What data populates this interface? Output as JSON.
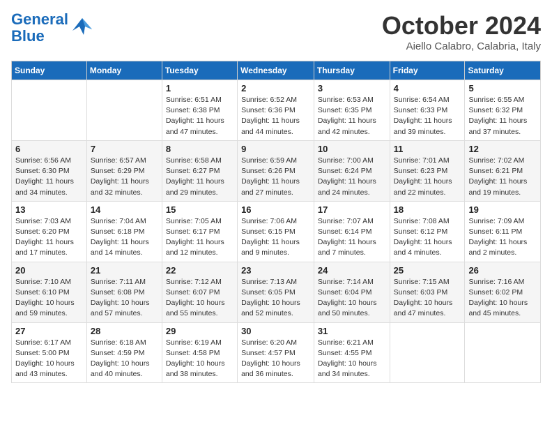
{
  "logo": {
    "line1": "General",
    "line2": "Blue"
  },
  "header": {
    "title": "October 2024",
    "location": "Aiello Calabro, Calabria, Italy"
  },
  "weekdays": [
    "Sunday",
    "Monday",
    "Tuesday",
    "Wednesday",
    "Thursday",
    "Friday",
    "Saturday"
  ],
  "weeks": [
    [
      {
        "day": "",
        "info": ""
      },
      {
        "day": "",
        "info": ""
      },
      {
        "day": "1",
        "info": "Sunrise: 6:51 AM\nSunset: 6:38 PM\nDaylight: 11 hours and 47 minutes."
      },
      {
        "day": "2",
        "info": "Sunrise: 6:52 AM\nSunset: 6:36 PM\nDaylight: 11 hours and 44 minutes."
      },
      {
        "day": "3",
        "info": "Sunrise: 6:53 AM\nSunset: 6:35 PM\nDaylight: 11 hours and 42 minutes."
      },
      {
        "day": "4",
        "info": "Sunrise: 6:54 AM\nSunset: 6:33 PM\nDaylight: 11 hours and 39 minutes."
      },
      {
        "day": "5",
        "info": "Sunrise: 6:55 AM\nSunset: 6:32 PM\nDaylight: 11 hours and 37 minutes."
      }
    ],
    [
      {
        "day": "6",
        "info": "Sunrise: 6:56 AM\nSunset: 6:30 PM\nDaylight: 11 hours and 34 minutes."
      },
      {
        "day": "7",
        "info": "Sunrise: 6:57 AM\nSunset: 6:29 PM\nDaylight: 11 hours and 32 minutes."
      },
      {
        "day": "8",
        "info": "Sunrise: 6:58 AM\nSunset: 6:27 PM\nDaylight: 11 hours and 29 minutes."
      },
      {
        "day": "9",
        "info": "Sunrise: 6:59 AM\nSunset: 6:26 PM\nDaylight: 11 hours and 27 minutes."
      },
      {
        "day": "10",
        "info": "Sunrise: 7:00 AM\nSunset: 6:24 PM\nDaylight: 11 hours and 24 minutes."
      },
      {
        "day": "11",
        "info": "Sunrise: 7:01 AM\nSunset: 6:23 PM\nDaylight: 11 hours and 22 minutes."
      },
      {
        "day": "12",
        "info": "Sunrise: 7:02 AM\nSunset: 6:21 PM\nDaylight: 11 hours and 19 minutes."
      }
    ],
    [
      {
        "day": "13",
        "info": "Sunrise: 7:03 AM\nSunset: 6:20 PM\nDaylight: 11 hours and 17 minutes."
      },
      {
        "day": "14",
        "info": "Sunrise: 7:04 AM\nSunset: 6:18 PM\nDaylight: 11 hours and 14 minutes."
      },
      {
        "day": "15",
        "info": "Sunrise: 7:05 AM\nSunset: 6:17 PM\nDaylight: 11 hours and 12 minutes."
      },
      {
        "day": "16",
        "info": "Sunrise: 7:06 AM\nSunset: 6:15 PM\nDaylight: 11 hours and 9 minutes."
      },
      {
        "day": "17",
        "info": "Sunrise: 7:07 AM\nSunset: 6:14 PM\nDaylight: 11 hours and 7 minutes."
      },
      {
        "day": "18",
        "info": "Sunrise: 7:08 AM\nSunset: 6:12 PM\nDaylight: 11 hours and 4 minutes."
      },
      {
        "day": "19",
        "info": "Sunrise: 7:09 AM\nSunset: 6:11 PM\nDaylight: 11 hours and 2 minutes."
      }
    ],
    [
      {
        "day": "20",
        "info": "Sunrise: 7:10 AM\nSunset: 6:10 PM\nDaylight: 10 hours and 59 minutes."
      },
      {
        "day": "21",
        "info": "Sunrise: 7:11 AM\nSunset: 6:08 PM\nDaylight: 10 hours and 57 minutes."
      },
      {
        "day": "22",
        "info": "Sunrise: 7:12 AM\nSunset: 6:07 PM\nDaylight: 10 hours and 55 minutes."
      },
      {
        "day": "23",
        "info": "Sunrise: 7:13 AM\nSunset: 6:05 PM\nDaylight: 10 hours and 52 minutes."
      },
      {
        "day": "24",
        "info": "Sunrise: 7:14 AM\nSunset: 6:04 PM\nDaylight: 10 hours and 50 minutes."
      },
      {
        "day": "25",
        "info": "Sunrise: 7:15 AM\nSunset: 6:03 PM\nDaylight: 10 hours and 47 minutes."
      },
      {
        "day": "26",
        "info": "Sunrise: 7:16 AM\nSunset: 6:02 PM\nDaylight: 10 hours and 45 minutes."
      }
    ],
    [
      {
        "day": "27",
        "info": "Sunrise: 6:17 AM\nSunset: 5:00 PM\nDaylight: 10 hours and 43 minutes."
      },
      {
        "day": "28",
        "info": "Sunrise: 6:18 AM\nSunset: 4:59 PM\nDaylight: 10 hours and 40 minutes."
      },
      {
        "day": "29",
        "info": "Sunrise: 6:19 AM\nSunset: 4:58 PM\nDaylight: 10 hours and 38 minutes."
      },
      {
        "day": "30",
        "info": "Sunrise: 6:20 AM\nSunset: 4:57 PM\nDaylight: 10 hours and 36 minutes."
      },
      {
        "day": "31",
        "info": "Sunrise: 6:21 AM\nSunset: 4:55 PM\nDaylight: 10 hours and 34 minutes."
      },
      {
        "day": "",
        "info": ""
      },
      {
        "day": "",
        "info": ""
      }
    ]
  ]
}
